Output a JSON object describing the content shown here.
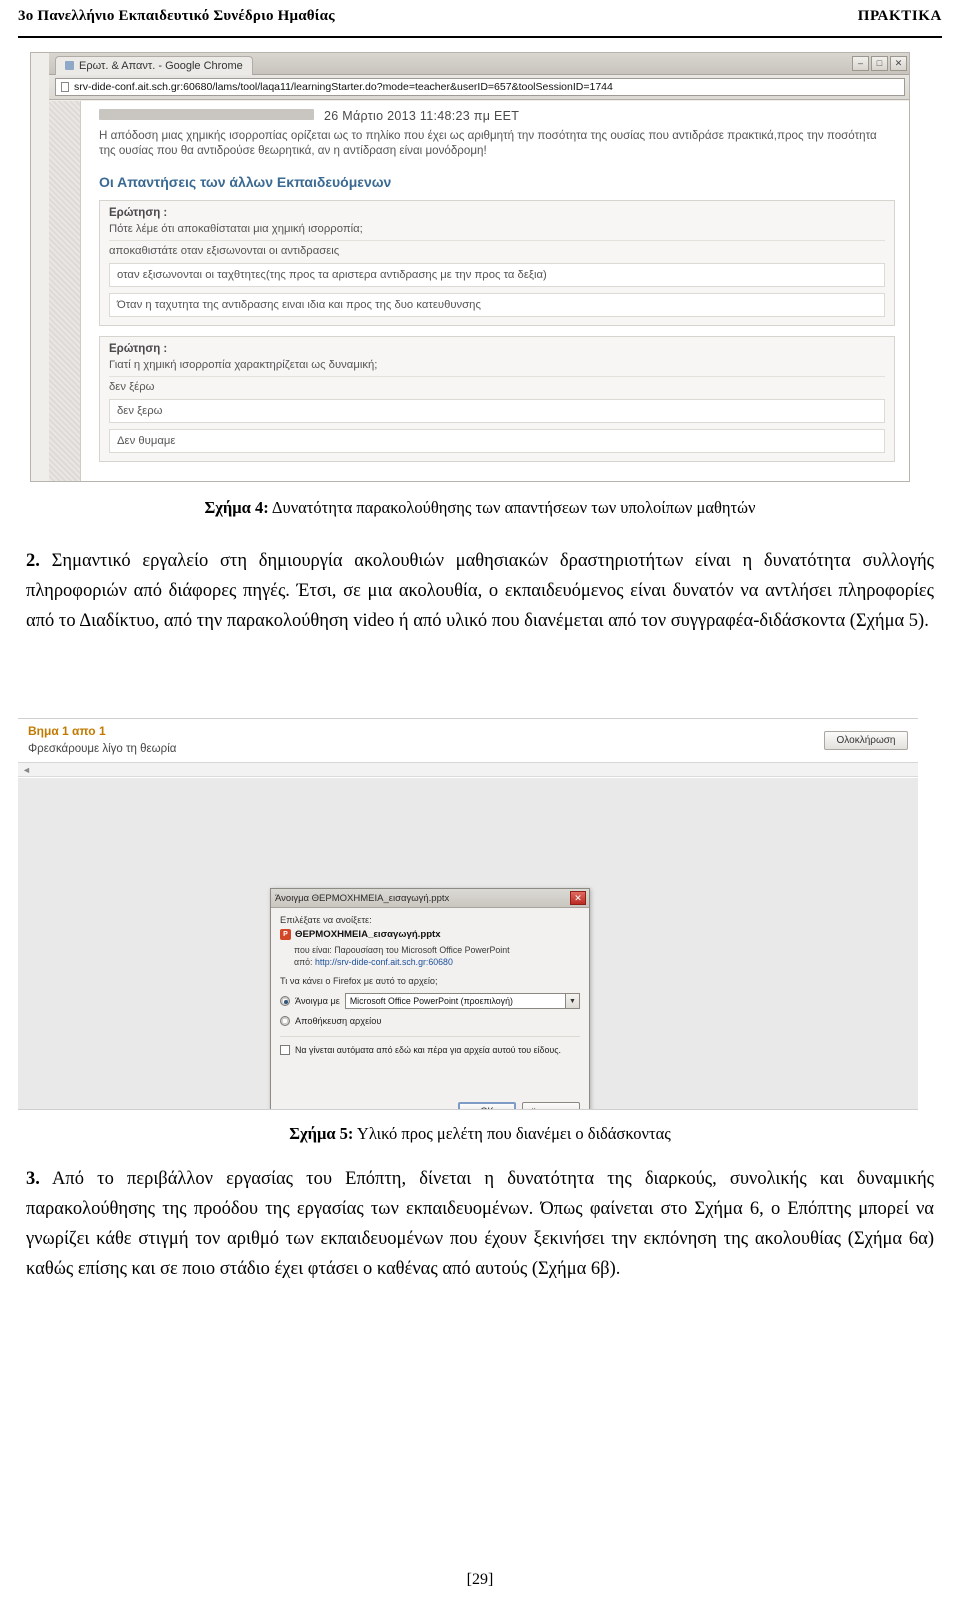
{
  "running_header": {
    "left": "3ο Πανελλήνιο Εκπαιδευτικό Συνέδριο Ημαθίας",
    "right": "ΠΡΑΚΤΙΚΑ"
  },
  "figure4": {
    "window_title": "Ερωτ. & Απαντ. - Google Chrome",
    "tab_label": "Ερωτ. & Απαντ. - Google Chrome",
    "win_buttons": [
      "–",
      "□",
      "✕"
    ],
    "url": "srv-dide-conf.ait.sch.gr:60680/lams/tool/laqa11/learningStarter.do?mode=teacher&userID=657&toolSessionID=1744",
    "timestamp": "26 Μάρτιο 2013 11:48:23 πμ EET",
    "intro_paragraph": "Η απόδοση μιας χημικής ισορροπίας ορίζεται ως το πηλίκο που έχει ως αριθμητή την ποσότητα της ουσίας που αντιδράσε πρακτικά,προς την ποσότητα της ουσίας που θα αντιδρούσε θεωρητικά, αν η αντίδραση είναι μονόδρομη!",
    "section_title": "Οι Απαντήσεις των άλλων Εκπαιδευόμενων",
    "question_blocks": [
      {
        "label": "Ερώτηση :",
        "question": "Πότε λέμε ότι αποκαθίσταται μια χημική ισορροπία;",
        "answers": [
          "αποκαθιστάτε οταν εξισωνονται οι αντιδρασεις",
          "οταν εξισωνονται οι ταχθτητες(της προς τα αριστερα αντιδρασης με την προς τα δεξια)",
          "Όταν η ταχυτητα της αντιδρασης ειναι ιδια και προς της δυο κατευθυνσης"
        ]
      },
      {
        "label": "Ερώτηση :",
        "question": "Γιατί η χημική ισορροπία χαρακτηρίζεται ως δυναμική;",
        "answers": [
          "δεν ξέρω",
          "δεν ξερω",
          "Δεν θυμαμε"
        ]
      }
    ],
    "caption": "Σχήμα 4: Δυνατότητα παρακολούθησης των απαντήσεων των υπολοίπων μαθητών",
    "caption_bold": "Σχήμα 4:",
    "caption_rest": " Δυνατότητα παρακολούθησης των απαντήσεων των υπολοίπων μαθητών"
  },
  "paragraph2": {
    "number": "2.",
    "text": " Σημαντικό εργαλείο στη δημιουργία ακολουθιών μαθησιακών δραστηριοτήτων είναι η δυνατότητα συλλογής πληροφοριών από διάφορες πηγές. Έτσι, σε μια ακολουθία, ο εκπαιδευόμενος είναι δυνατόν να αντλήσει πληροφορίες από το Διαδίκτυο, από την παρακολούθηση video ή από υλικό που διανέμεται από τον συγγραφέα-διδάσκοντα (Σχήμα 5)."
  },
  "figure5": {
    "step_label": "Βημα 1 απο 1",
    "subtitle": "Φρεσκάρουμε λίγο τη θεωρία",
    "finish_button": "Ολοκλήρωση",
    "scroll_hint": "◄",
    "dialog": {
      "title": "Άνοιγμα ΘΕΡΜΟΧΗΜΕΙΑ_εισαγωγή.pptx",
      "close_label": "✕",
      "prompt": "Επιλέξατε να ανοίξετε:",
      "file_icon": "P",
      "file_name": "ΘΕΡΜΟΧΗΜΕΙΑ_εισαγωγή.pptx",
      "meta_type_label": "που είναι:",
      "meta_type_value": "Παρουσίαση του Microsoft Office PowerPoint",
      "meta_from_label": "από:",
      "meta_from_value": "http://srv-dide-conf.ait.sch.gr:60680",
      "question": "Τι να κάνει ο Firefox με αυτό το αρχείο;",
      "option_open_label": "Άνοιγμα με",
      "option_open_app": "Microsoft Office PowerPoint (προεπιλογή)",
      "option_save_label": "Αποθήκευση αρχείου",
      "checkbox_label": "Να γίνεται αυτόματα από εδώ και πέρα για αρχεία αυτού του είδους.",
      "ok_button": "OK",
      "cancel_button": "Άκυρωση"
    },
    "caption_bold": "Σχήμα 5:",
    "caption_rest": " Υλικό προς μελέτη που διανέμει ο διδάσκοντας"
  },
  "paragraph3": {
    "number": "3.",
    "text": " Από το περιβάλλον εργασίας του Επόπτη, δίνεται η δυνατότητα της διαρκούς, συνολικής και δυναμικής παρακολούθησης της προόδου της εργασίας των εκπαιδευομένων. Όπως φαίνεται στο Σχήμα 6, ο Επόπτης μπορεί να γνωρίζει κάθε στιγμή τον αριθμό των εκπαιδευομένων που έχουν ξεκινήσει την εκπόνηση της ακολουθίας (Σχήμα 6α) καθώς επίσης και σε ποιο στάδιο έχει φτάσει ο καθένας από αυτούς (Σχήμα 6β)."
  },
  "page_number": "[29]"
}
